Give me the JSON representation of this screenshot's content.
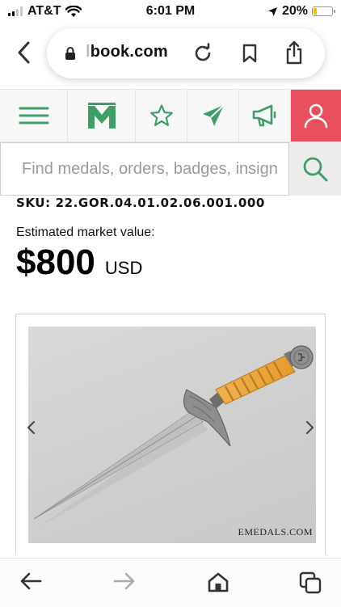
{
  "status_bar": {
    "carrier": "AT&T",
    "time": "6:01 PM",
    "battery": "20%",
    "battery_level": 0.2
  },
  "browser": {
    "url_prefix": "l",
    "url_main": "book.com"
  },
  "nav": {
    "items": [
      "menu-icon",
      "logo",
      "star-icon",
      "send-icon",
      "megaphone-icon",
      "user-icon"
    ]
  },
  "search": {
    "placeholder": "Find medals, orders, badges, insign"
  },
  "item": {
    "sku": "SKU: 22.GOR.04.01.02.06.001.000",
    "estimated_label": "Estimated market value:",
    "price": "$800",
    "currency": "USD",
    "watermark": "EMEDALS.COM"
  },
  "colors": {
    "brand_green": "#3f9e68",
    "user_red": "#e8505f"
  }
}
